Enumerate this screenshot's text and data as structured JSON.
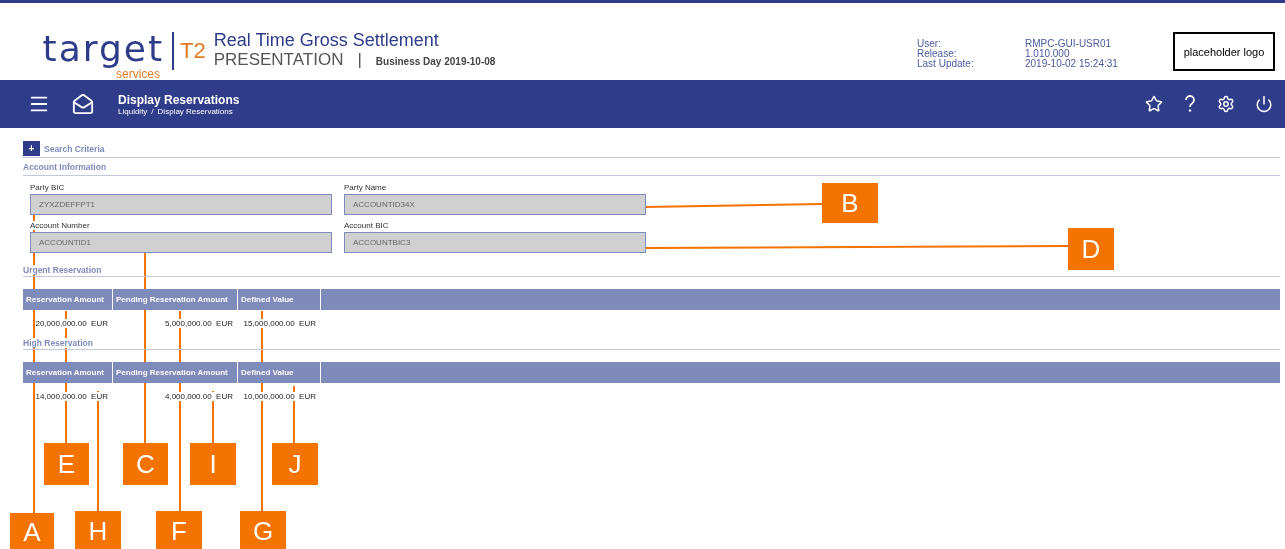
{
  "header": {
    "logo": {
      "word": "target",
      "sub": "services"
    },
    "app_code": "T2",
    "title": "Real Time Gross Settlement",
    "environment": "PRESENTATION",
    "separator": "|",
    "business_day": "Business Day 2019-10-08",
    "info": [
      {
        "label": "User:",
        "value": "RMPC-GUI-USR01"
      },
      {
        "label": "Release:",
        "value": "1.010.000"
      },
      {
        "label": "Last Update:",
        "value": "2019-10-02 15:24:31"
      }
    ],
    "placeholder_logo": "placeholder logo"
  },
  "nav": {
    "page_title": "Display Reservations",
    "breadcrumb": [
      "Liquidity",
      "Display Reservations"
    ],
    "breadcrumb_separator": "/"
  },
  "search_criteria": {
    "toggle": "+",
    "label": "Search Criteria"
  },
  "account_information": {
    "title": "Account Information",
    "fields": [
      {
        "label": "Party BIC",
        "value": "ZYXZDEFFPT1"
      },
      {
        "label": "Party Name",
        "value": "ACCOUNTID34X"
      },
      {
        "label": "Account Number",
        "value": "ACCOUNTID1"
      },
      {
        "label": "Account BIC",
        "value": "ACCOUNTBIC3"
      }
    ]
  },
  "sections": [
    {
      "title": "Urgent Reservation",
      "columns": [
        "Reservation Amount",
        "Pending Reservation Amount",
        "Defined Value"
      ],
      "rows": [
        [
          "20,000,000.00  EUR",
          "5,000,000.00  EUR",
          "15,000,000.00  EUR"
        ]
      ]
    },
    {
      "title": "High Reservation",
      "columns": [
        "Reservation Amount",
        "Pending Reservation Amount",
        "Defined Value"
      ],
      "rows": [
        [
          "14,000,000.00  EUR",
          "4,000,000.00  EUR",
          "10,000,000.00  EUR"
        ]
      ]
    }
  ],
  "callouts": [
    "B",
    "D",
    "E",
    "C",
    "I",
    "J",
    "A",
    "H",
    "F",
    "G"
  ]
}
